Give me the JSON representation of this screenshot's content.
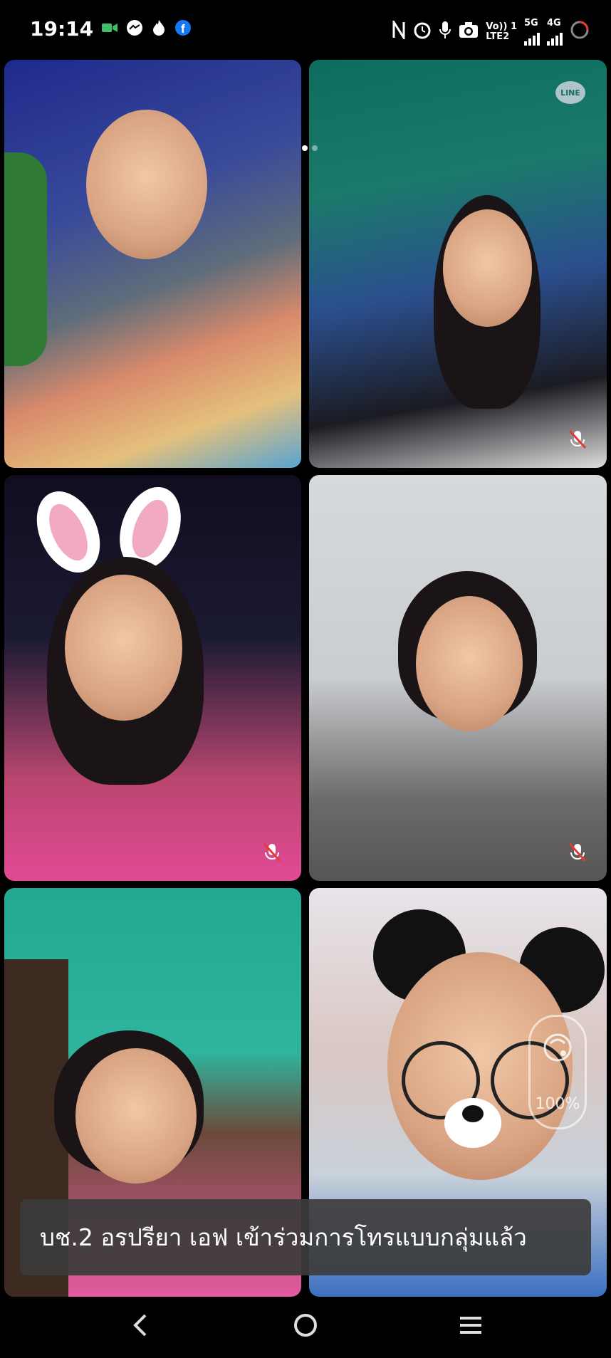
{
  "status_bar": {
    "time": "19:14",
    "notification_icons": [
      "video-camera-icon",
      "messenger-icon",
      "flame-icon",
      "facebook-icon"
    ],
    "system_icons": [
      "nfc-icon",
      "alarm-icon",
      "mic-icon",
      "camera-icon"
    ],
    "volte_label_top": "Vo)) 1",
    "volte_label_bottom": "LTE2",
    "net1": "5G",
    "net2": "4G",
    "battery_icon": "battery-ring-icon"
  },
  "call": {
    "pager_dots": 2,
    "app_badge": "LINE",
    "participants": [
      {
        "position": "top-left",
        "muted": false
      },
      {
        "position": "top-right",
        "muted": true
      },
      {
        "position": "middle-left",
        "muted": true,
        "filter": "bunny-ears"
      },
      {
        "position": "middle-right",
        "muted": true
      },
      {
        "position": "bottom-left",
        "muted": false
      },
      {
        "position": "bottom-right",
        "muted": true,
        "filter": "panda-glasses"
      }
    ],
    "beauty_level": "100%"
  },
  "toast": {
    "message": "บช.2 อรปรียา เอฟ เข้าร่วมการโทรแบบกลุ่มแล้ว"
  },
  "nav": {
    "back_icon": "back-chevron-icon",
    "home_icon": "home-circle-icon",
    "menu_icon": "recents-menu-icon"
  },
  "colors": {
    "background": "#000000",
    "toast_bg": "#3c3c3c"
  }
}
